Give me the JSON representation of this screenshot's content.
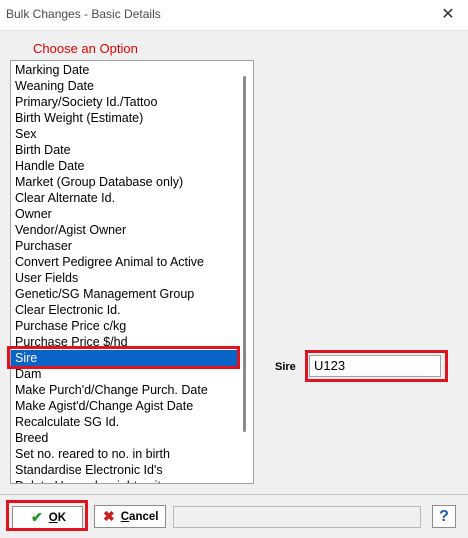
{
  "window": {
    "title": "Bulk Changes - Basic Details",
    "close_glyph": "✕"
  },
  "chooser": {
    "label": "Choose an Option",
    "items": [
      "Marking Date",
      "Weaning Date",
      "Primary/Society Id./Tattoo",
      "Birth Weight (Estimate)",
      "Sex",
      "Birth Date",
      "Handle Date",
      "Market (Group Database only)",
      "Clear Alternate Id.",
      "Owner",
      "Vendor/Agist Owner",
      "Purchaser",
      "Convert Pedigree Animal to Active",
      "User Fields",
      "Genetic/SG Management Group",
      "Clear Electronic Id.",
      "Purchase Price c/kg",
      "Purchase Price $/hd",
      "Sire",
      "Dam",
      "Make Purch'd/Change Purch. Date",
      "Make Agist'd/Change Agist Date",
      "Recalculate SG Id.",
      "Breed",
      "Set no. reared to no. in birth",
      "Standardise Electronic Id's",
      "Delete Unused weight units"
    ],
    "selected_index": 18
  },
  "field": {
    "label": "Sire",
    "value": "U123"
  },
  "buttons": {
    "ok": {
      "accel": "O",
      "rest": "K",
      "icon": "✔"
    },
    "cancel": {
      "accel": "C",
      "rest": "ancel",
      "icon": "✖"
    },
    "help": {
      "glyph": "?"
    }
  },
  "colors": {
    "highlight_box": "#e0141e",
    "selection": "#0a64c8",
    "choose_label": "#e00000",
    "ok_icon": "#1a9a2a",
    "cancel_icon": "#c81e1e",
    "help_icon": "#1a5aa8"
  }
}
